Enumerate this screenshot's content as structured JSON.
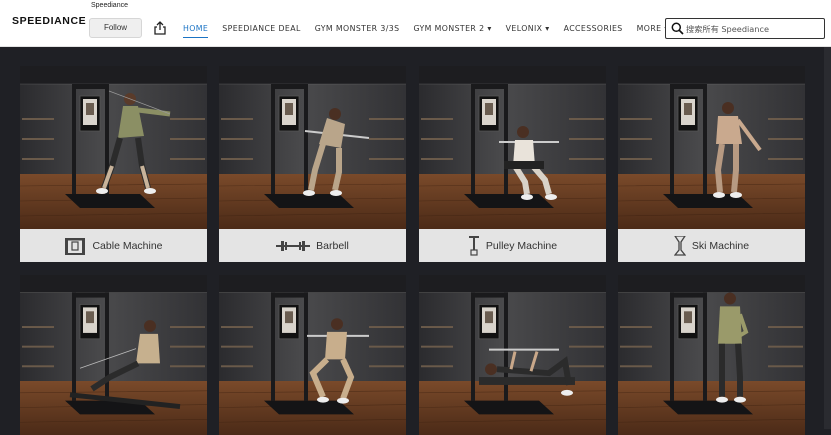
{
  "store": {
    "logo_text": "SPEEDIANCE",
    "name": "Speediance",
    "follow_label": "Follow"
  },
  "nav": [
    {
      "label": "HOME",
      "active": true
    },
    {
      "label": "SPEEDIANCE DEAL"
    },
    {
      "label": "GYM MONSTER 3/3S"
    },
    {
      "label": "GYM MONSTER 2 ▾"
    },
    {
      "label": "VELONIX ▾"
    },
    {
      "label": "ACCESSORIES"
    },
    {
      "label": "MORE ▾"
    }
  ],
  "search": {
    "placeholder": "搜索所有 Speediance"
  },
  "tiles": [
    {
      "label": "Cable Machine",
      "icon": "cable-machine-icon"
    },
    {
      "label": "Barbell",
      "icon": "barbell-icon"
    },
    {
      "label": "Pulley Machine",
      "icon": "pulley-machine-icon"
    },
    {
      "label": "Ski Machine",
      "icon": "ski-machine-icon"
    },
    {
      "icon": "rower-photo"
    },
    {
      "icon": "squat-photo"
    },
    {
      "icon": "bench-press-photo"
    },
    {
      "icon": "curl-photo"
    }
  ],
  "colors": {
    "accent": "#1a73c4",
    "background": "#1f2025",
    "caption_bg": "#e4e4e4",
    "floor": "#6b3f24",
    "wall": "#3a3b3e"
  }
}
